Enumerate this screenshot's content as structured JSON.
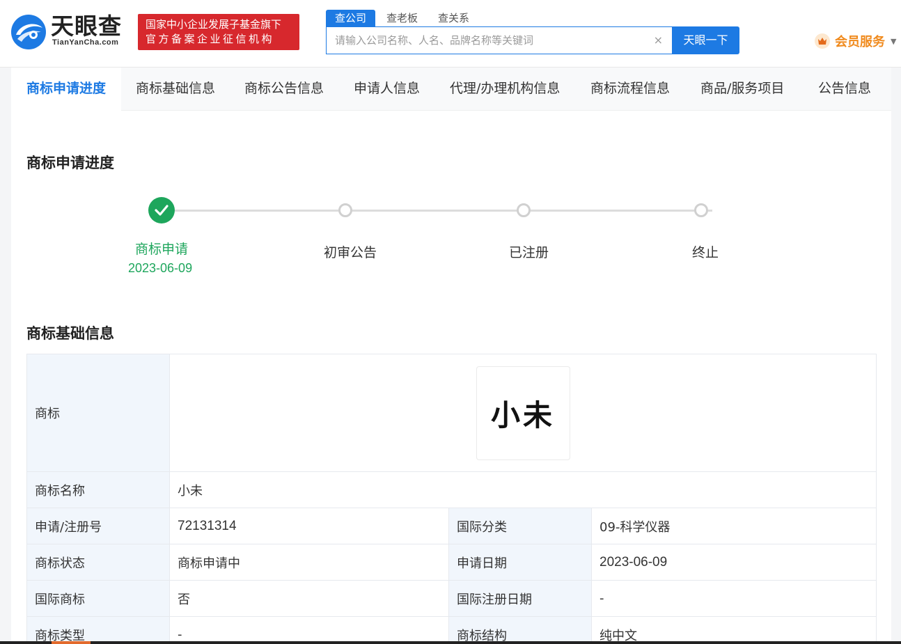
{
  "header": {
    "logo_title": "天眼查",
    "logo_sub": "TianYanCha.com",
    "badge_line1": "国家中小企业发展子基金旗下",
    "badge_line2": "官方备案企业征信机构",
    "search_tabs": [
      "查公司",
      "查老板",
      "查关系"
    ],
    "search_placeholder": "请输入公司名称、人名、品牌名称等关键词",
    "clear_icon": "×",
    "search_button": "天眼一下",
    "member_label": "会员服务"
  },
  "tabs": [
    "商标申请进度",
    "商标基础信息",
    "商标公告信息",
    "申请人信息",
    "代理/办理机构信息",
    "商标流程信息",
    "商品/服务项目",
    "公告信息"
  ],
  "progress": {
    "title": "商标申请进度",
    "steps": [
      {
        "label": "商标申请",
        "date": "2023-06-09",
        "status": "done"
      },
      {
        "label": "初审公告",
        "status": "pending"
      },
      {
        "label": "已注册",
        "status": "pending"
      },
      {
        "label": "终止",
        "status": "pending"
      }
    ]
  },
  "basic": {
    "title": "商标基础信息",
    "mark_label": "商标",
    "mark_image_text": "小未",
    "name_label": "商标名称",
    "name_value": "小未",
    "rows": [
      {
        "k1": "申请/注册号",
        "v1": "72131314",
        "k2": "国际分类",
        "v2": "09-科学仪器"
      },
      {
        "k1": "商标状态",
        "v1": "商标申请中",
        "k2": "申请日期",
        "v2": "2023-06-09"
      },
      {
        "k1": "国际商标",
        "v1": "否",
        "k2": "国际注册日期",
        "v2": "-"
      },
      {
        "k1": "商标类型",
        "v1": "-",
        "k2": "商标结构",
        "v2": "纯中文"
      }
    ]
  },
  "colors": {
    "brand_blue": "#1d7ae3",
    "success_green": "#1ea65c",
    "badge_red": "#d7282d",
    "member_orange": "#f08a1d"
  }
}
